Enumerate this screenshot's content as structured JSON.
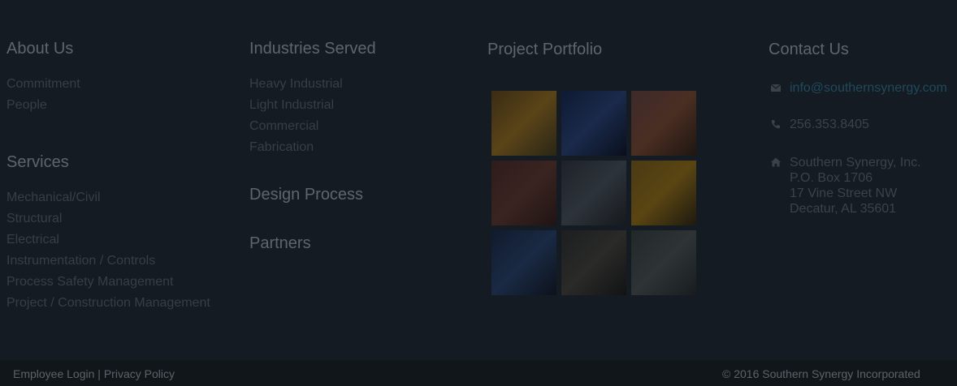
{
  "about": {
    "heading": "About Us",
    "items": [
      "Commitment",
      "People"
    ]
  },
  "services": {
    "heading": "Services",
    "items": [
      "Mechanical/Civil",
      "Structural",
      "Electrical",
      "Instrumentation / Controls",
      "Process Safety Management",
      "Project / Construction Management"
    ]
  },
  "industries": {
    "heading": "Industries Served",
    "items": [
      "Heavy Industrial",
      "Light Industrial",
      "Commercial",
      "Fabrication"
    ]
  },
  "design_process": {
    "heading": "Design Process"
  },
  "partners": {
    "heading": "Partners"
  },
  "portfolio": {
    "heading": "Project Portfolio",
    "tiles": [
      {
        "name": "refinery-pipes-photo",
        "colors": [
          "#3a2c14",
          "#5a4418",
          "#2a2616"
        ]
      },
      {
        "name": "workers-on-structure-photo",
        "colors": [
          "#0f1a33",
          "#1a2a4a",
          "#0a0f1c"
        ]
      },
      {
        "name": "plant-at-dusk-photo",
        "colors": [
          "#3e2a2a",
          "#4a2e22",
          "#1f1612"
        ]
      },
      {
        "name": "steel-framework-photo",
        "colors": [
          "#2e1c1c",
          "#3a2420",
          "#1f1414"
        ]
      },
      {
        "name": "industrial-interior-photo",
        "colors": [
          "#1e2228",
          "#2d333a",
          "#16191d"
        ]
      },
      {
        "name": "worker-silhouette-photo",
        "colors": [
          "#4a3a14",
          "#5a4512",
          "#1e1a10"
        ]
      },
      {
        "name": "gas-holder-tower-photo",
        "colors": [
          "#101a2c",
          "#1a2a44",
          "#0c121c"
        ]
      },
      {
        "name": "machinery-gears-photo",
        "colors": [
          "#1c1e20",
          "#2a2a28",
          "#121314"
        ]
      },
      {
        "name": "steel-beams-perspective-photo",
        "colors": [
          "#22282a",
          "#2e3436",
          "#181c1e"
        ]
      }
    ]
  },
  "contact": {
    "heading": "Contact Us",
    "email": "info@southernsynergy.com",
    "phone": "256.353.8405",
    "address": [
      "Southern Synergy, Inc.",
      "P.O. Box 1706",
      "17 Vine Street NW",
      "Decatur, AL 35601"
    ],
    "email_color": "#1f4a5e"
  },
  "footer": {
    "employee_login": "Employee Login",
    "separator": "|",
    "privacy_policy": "Privacy Policy",
    "copyright": "© 2016 Southern Synergy Incorporated"
  },
  "icons": {
    "email": "envelope-icon",
    "phone": "phone-icon",
    "address": "home-icon"
  }
}
